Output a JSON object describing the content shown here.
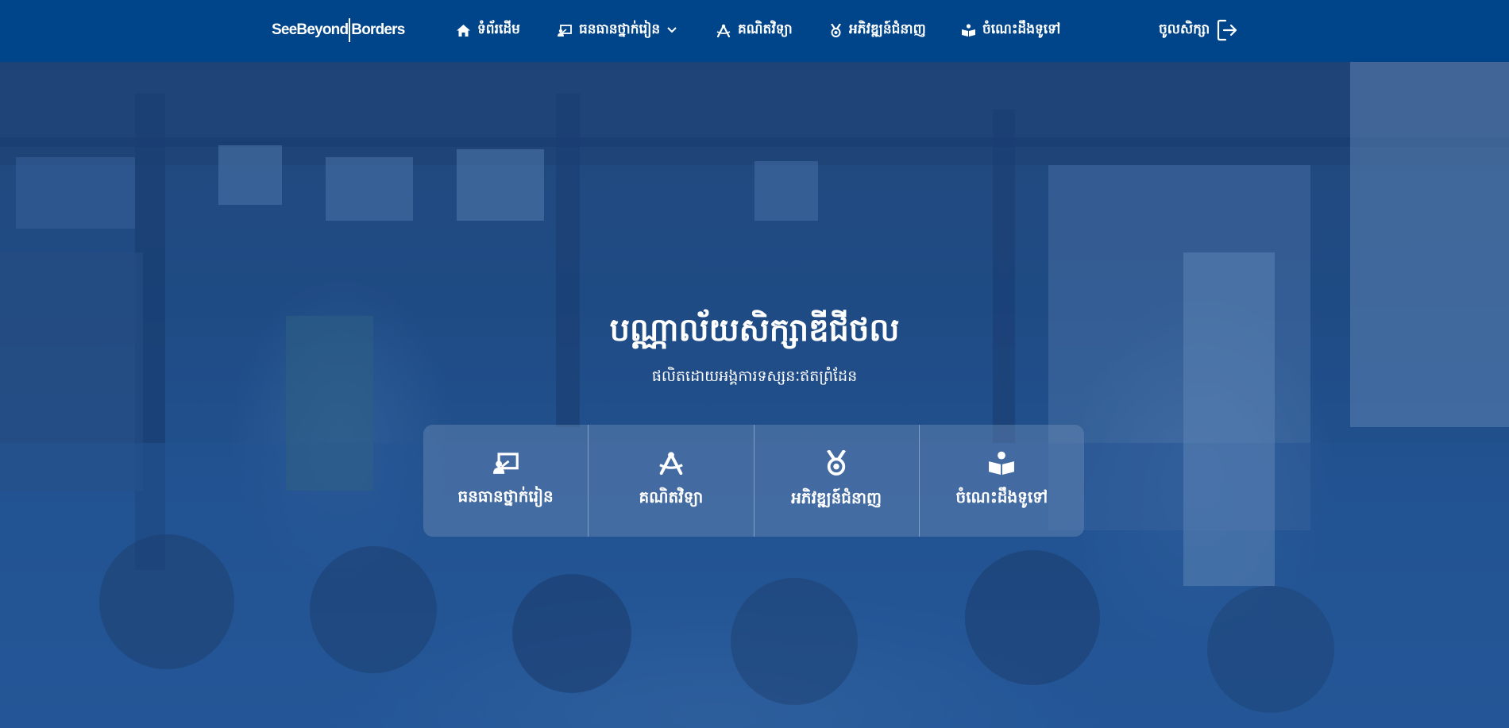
{
  "brand": {
    "logo_left": "SeeBeyond",
    "logo_right": "Borders"
  },
  "nav": {
    "home": {
      "label": "ទំព័រដើម",
      "icon": "home-icon"
    },
    "lessons": {
      "label": "ធនធានថ្នាក់រៀន",
      "icon": "classroom-icon",
      "dropdown_icon": "chevron-down-icon"
    },
    "math": {
      "label": "គណិតវិទ្យា",
      "icon": "compass-icon"
    },
    "skills": {
      "label": "អភិវឌ្ឍន៍ជំនាញ",
      "icon": "medal-icon"
    },
    "general": {
      "label": "ចំណេះដឹងទូទៅ",
      "icon": "book-reader-icon"
    },
    "login": {
      "label": "ចូលសិក្សា",
      "icon": "logout-icon"
    }
  },
  "hero": {
    "title": "បណ្ណាល័យសិក្សាឌីជីថល",
    "subtitle": "ផលិតដោយអង្គការទស្សនៈឥតព្រំដែន"
  },
  "cards": [
    {
      "label": "ធនធានថ្នាក់រៀន",
      "icon": "classroom-icon"
    },
    {
      "label": "គណិតវិទ្យា",
      "icon": "compass-icon"
    },
    {
      "label": "អភិវឌ្ឍន៍ជំនាញ",
      "icon": "medal-icon"
    },
    {
      "label": "ចំណេះដឹងទូទៅ",
      "icon": "book-reader-icon"
    }
  ],
  "colors": {
    "nav_bg": "#00458a",
    "text": "#ffffff"
  }
}
